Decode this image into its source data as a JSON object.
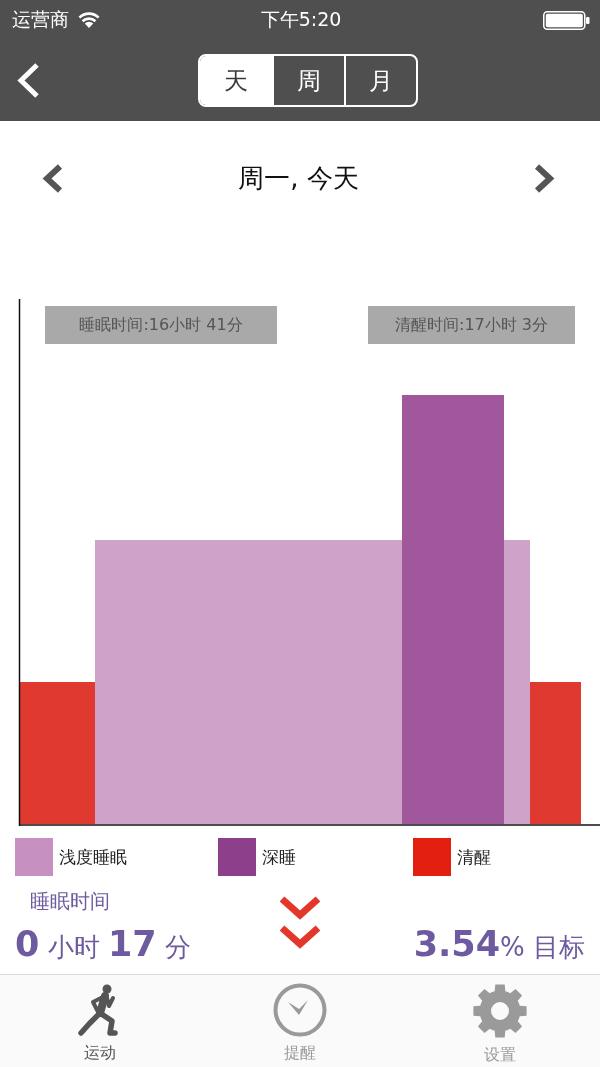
{
  "status_bar": {
    "carrier": "运营商",
    "time": "下午5:20"
  },
  "nav_bar": {
    "segments": [
      {
        "label": "天",
        "selected": true
      },
      {
        "label": "周",
        "selected": false
      },
      {
        "label": "月",
        "selected": false
      }
    ]
  },
  "date_nav": {
    "title": "周一, 今天"
  },
  "chart": {
    "labels": [
      "睡眠时间:16小时 41分",
      "清醒时间:17小时 3分"
    ]
  },
  "legend": [
    {
      "label": "浅度睡眠",
      "color": "#c690c0"
    },
    {
      "label": "深睡",
      "color": "#8e3f8c"
    },
    {
      "label": "清醒",
      "color": "#e3200f"
    }
  ],
  "summary": {
    "title": "睡眠时间",
    "duration": "**0** 小时 **17** 分",
    "goal": "**3.54**% 目标"
  },
  "tab_bar": [
    {
      "label": "运动",
      "selected": true
    },
    {
      "label": "提醒",
      "selected": false
    },
    {
      "label": "设置",
      "selected": false
    }
  ]
}
